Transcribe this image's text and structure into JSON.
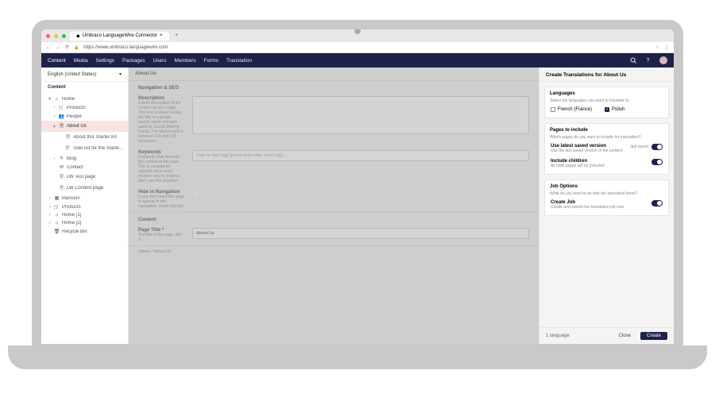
{
  "browser": {
    "tab_title": "Umbraco LanguageWire Connector",
    "url": "https://www.umbraco.languagewire.com",
    "dots": [
      "#ff5f56",
      "#ffbd2e",
      "#27c93f"
    ],
    "favicon": "U"
  },
  "nav": {
    "items": [
      "Content",
      "Media",
      "Settings",
      "Packages",
      "Users",
      "Members",
      "Forms",
      "Translation"
    ],
    "active": "Content",
    "icons": {
      "search": "search-icon",
      "help": "help-icon"
    }
  },
  "sidebar": {
    "language": "English (United States)",
    "section": "Content",
    "tree": [
      {
        "label": "Home",
        "icon": "home-icon",
        "depth": 0,
        "caret": "▾"
      },
      {
        "label": "Products",
        "icon": "cart-icon",
        "depth": 1,
        "caret": "›"
      },
      {
        "label": "People",
        "icon": "people-icon",
        "depth": 1,
        "caret": "›"
      },
      {
        "label": "About Us",
        "icon": "doc-icon",
        "depth": 1,
        "caret": "▾",
        "active": true
      },
      {
        "label": "About this Starter Kit",
        "icon": "doc-icon",
        "depth": 2
      },
      {
        "label": "Todo list for the Starter Kit",
        "icon": "doc-icon",
        "depth": 2
      },
      {
        "label": "Blog",
        "icon": "blog-icon",
        "depth": 1,
        "caret": "›"
      },
      {
        "label": "Contact",
        "icon": "contact-icon",
        "depth": 1
      },
      {
        "label": "LW Test page",
        "icon": "doc-icon",
        "depth": 1
      },
      {
        "label": "LW Content page",
        "icon": "doc-icon",
        "depth": 1
      },
      {
        "label": "Mansion",
        "icon": "grid-icon",
        "depth": 0,
        "caret": "›"
      },
      {
        "label": "Products",
        "icon": "cart-icon",
        "depth": 0,
        "caret": "›"
      },
      {
        "label": "Home [1]",
        "icon": "home-icon",
        "depth": 0,
        "caret": "›"
      },
      {
        "label": "Home [2]",
        "icon": "home-icon",
        "depth": 0,
        "caret": "›"
      },
      {
        "label": "Recycle Bin",
        "icon": "trash-icon",
        "depth": 0
      }
    ]
  },
  "content": {
    "title": "About Us",
    "sections": {
      "nav_seo": "Navigation & SEO",
      "content": "Content"
    },
    "fields": {
      "description": {
        "label": "Description",
        "help": "A brief description of the content on your page. This text is shown below the title in a google search result and also used for Social Sharing Cards. The ideal length is between 130 and 155 characters"
      },
      "keywords": {
        "label": "Keywords",
        "help": "Keywords that describe the content of the page. This is considered optional since most modern search engines don't use this anymore",
        "placeholder": "Type to add tags (press enter after each tag)…"
      },
      "hide_nav": {
        "label": "Hide in Navigation",
        "help": "If you don't want this page to appear in the navigation, check this box"
      },
      "page_title": {
        "label": "Page Title *",
        "help": "The title of the page, this is…",
        "value": "About Us"
      }
    },
    "breadcrumb": "Home / About Us"
  },
  "panel": {
    "title": "Create Translations for About Us",
    "languages": {
      "title": "Languages",
      "help": "Select the languages you want to translate to",
      "options": [
        {
          "label": "French (France)",
          "checked": false
        },
        {
          "label": "Polish",
          "checked": true
        }
      ]
    },
    "pages": {
      "title": "Pages to include",
      "help": "Which pages do you want to include for translation?",
      "latest": {
        "title": "Use latest saved version",
        "help": "Use the last saved version of the content",
        "badge": "last saved",
        "on": true
      },
      "children": {
        "title": "Include children",
        "help": "All child pages will be included",
        "on": true
      }
    },
    "job": {
      "title": "Job Options",
      "help": "What do you want to do with the translated items?",
      "create": {
        "title": "Create Job",
        "help": "Create and submit the translation job now",
        "on": true
      }
    },
    "footer": {
      "summary": "1 language",
      "close": "Close",
      "create": "Create"
    }
  }
}
